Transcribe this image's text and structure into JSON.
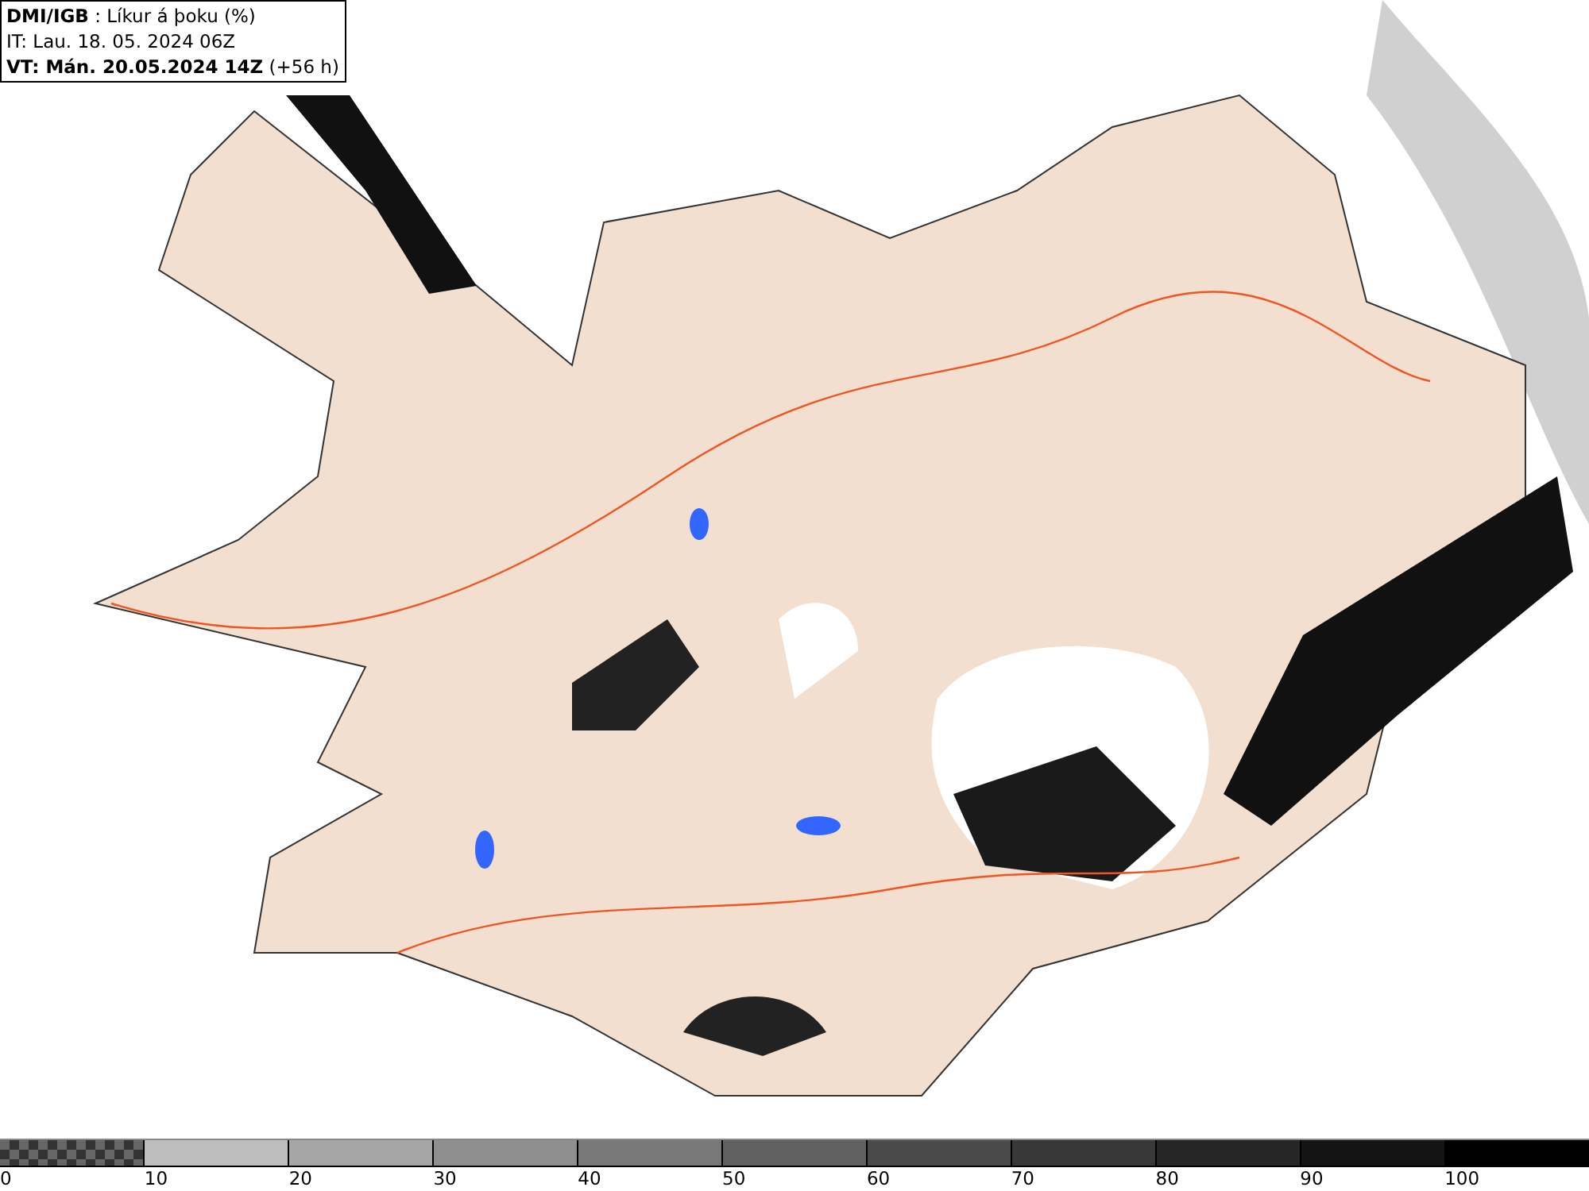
{
  "header": {
    "lines": [
      "**DMI/IGB** : Líkur á þoku (%)",
      "IT: Lau. 18. 05. 2024 06Z",
      "**VT: Mán. 20.05.2024 14Z** (+56 h)"
    ]
  },
  "legend": {
    "bins": [
      {
        "label": "0",
        "kind": "checker"
      },
      {
        "label": "10",
        "kind": "solid",
        "color": "#bdbdbd"
      },
      {
        "label": "20",
        "kind": "solid",
        "color": "#a6a6a6"
      },
      {
        "label": "30",
        "kind": "solid",
        "color": "#8f8f8f"
      },
      {
        "label": "40",
        "kind": "solid",
        "color": "#787878"
      },
      {
        "label": "50",
        "kind": "solid",
        "color": "#616161"
      },
      {
        "label": "60",
        "kind": "solid",
        "color": "#4a4a4a"
      },
      {
        "label": "70",
        "kind": "solid",
        "color": "#383838"
      },
      {
        "label": "80",
        "kind": "solid",
        "color": "#262626"
      },
      {
        "label": "90",
        "kind": "solid",
        "color": "#141414"
      },
      {
        "label": "100",
        "kind": "solid",
        "color": "#000000"
      }
    ]
  }
}
